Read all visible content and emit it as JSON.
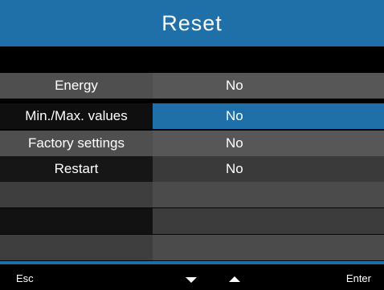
{
  "header": {
    "title": "Reset"
  },
  "menu": {
    "items": [
      {
        "label": "Energy",
        "value": "No"
      },
      {
        "label": "Min./Max. values",
        "value": "No"
      },
      {
        "label": "Factory settings",
        "value": "No"
      },
      {
        "label": "Restart",
        "value": "No"
      }
    ],
    "selected_index": 1
  },
  "footer": {
    "esc_label": "Esc",
    "down_icon": "triangle-down",
    "up_icon": "triangle-up",
    "enter_label": "Enter"
  },
  "colors": {
    "accent": "#1f6fa8",
    "background": "#000000"
  }
}
